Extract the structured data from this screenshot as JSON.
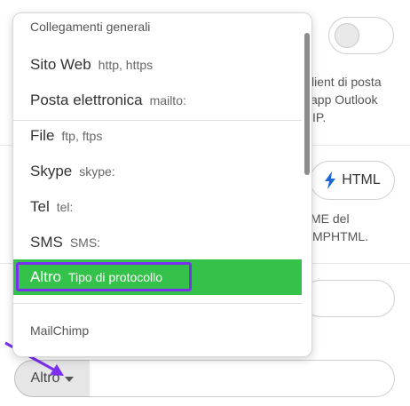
{
  "background": {
    "client_text_lines": [
      "client di posta",
      "app Outlook",
      "IP."
    ],
    "html_button_label": "HTML",
    "mime_text_lines": [
      "ME del",
      "MPHTML."
    ],
    "accent_bolt": "#1b67d8"
  },
  "protocol_select": {
    "value": "Altro",
    "url_value": ""
  },
  "dropdown": {
    "group1_header": "Collegamenti generali",
    "items": [
      {
        "label": "Sito Web",
        "hint": "http, https"
      },
      {
        "label": "Posta elettronica",
        "hint": "mailto:"
      },
      {
        "label": "File",
        "hint": "ftp, ftps"
      },
      {
        "label": "Skype",
        "hint": "skype:"
      },
      {
        "label": "Tel",
        "hint": "tel:"
      },
      {
        "label": "SMS",
        "hint": "SMS:"
      },
      {
        "label": "Altro",
        "hint": "Tipo di protocollo",
        "selected": true
      }
    ],
    "group2_header": "MailChimp"
  },
  "colors": {
    "selected_bg": "#34c24a",
    "highlight_outline": "#7b2ff0",
    "annotation_arrow": "#7b2ff0"
  }
}
